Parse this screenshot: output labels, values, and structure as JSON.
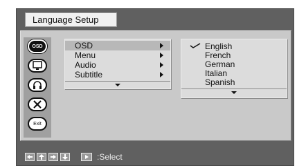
{
  "window": {
    "title": "Language Setup"
  },
  "sidebar": {
    "icons": [
      {
        "name": "osd",
        "label": "OSD",
        "active": true
      },
      {
        "name": "picture",
        "label": "",
        "active": false
      },
      {
        "name": "audio",
        "label": "",
        "active": false
      },
      {
        "name": "tools",
        "label": "",
        "active": false
      },
      {
        "name": "exit",
        "label": "Exit",
        "active": false
      }
    ]
  },
  "menu": {
    "items": [
      {
        "label": "OSD",
        "selected": true
      },
      {
        "label": "Menu",
        "selected": false
      },
      {
        "label": "Audio",
        "selected": false
      },
      {
        "label": "Subtitle",
        "selected": false
      }
    ]
  },
  "languages": {
    "items": [
      {
        "label": "English",
        "checked": true
      },
      {
        "label": "French",
        "checked": false
      },
      {
        "label": "German",
        "checked": false
      },
      {
        "label": "Italian",
        "checked": false
      },
      {
        "label": "Spanish",
        "checked": false
      }
    ]
  },
  "footer": {
    "select_label": ":Select"
  }
}
